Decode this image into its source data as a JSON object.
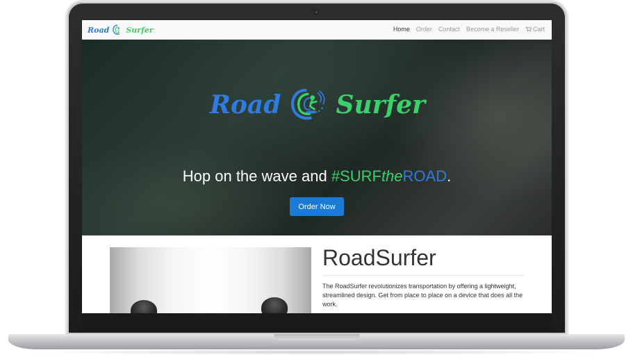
{
  "brand": {
    "word1": "Road",
    "word2": "Surfer",
    "logo_icon": "wave-surfer-icon",
    "colors": {
      "blue": "#2f7be0",
      "green": "#3bd16a"
    }
  },
  "nav": {
    "items": [
      {
        "label": "Home",
        "active": true
      },
      {
        "label": "Order"
      },
      {
        "label": "Contact"
      },
      {
        "label": "Become a Reseller"
      },
      {
        "label": "Cart",
        "icon": "cart-icon"
      }
    ]
  },
  "hero": {
    "tagline_prefix": "Hop on the wave and ",
    "hash_surf": "#SURF",
    "hash_the": "the",
    "hash_road": "ROAD",
    "tagline_suffix": ".",
    "cta_label": "Order Now",
    "cta_color": "#1a7ad6"
  },
  "product": {
    "title": "RoadSurfer",
    "description": "The RoadSurfer revolutionizes transportation by offering a lightweight, streamlined design. Get from place to place on a device that does all the work."
  }
}
